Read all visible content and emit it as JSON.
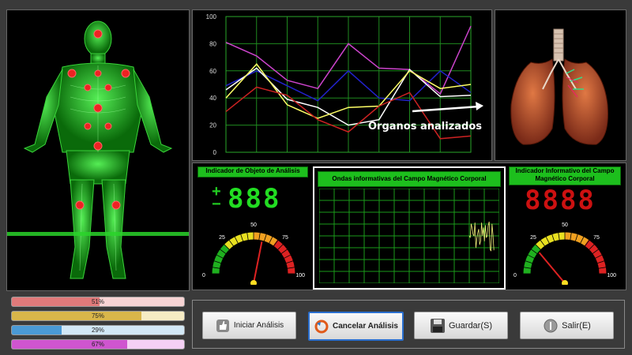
{
  "chart": {
    "yticks": [
      "100",
      "80",
      "60",
      "40",
      "20",
      "0"
    ],
    "series": [
      {
        "color": "#cc44cc",
        "values": [
          81,
          71,
          53,
          47,
          80,
          62,
          61,
          43,
          93
        ]
      },
      {
        "color": "#2222cc",
        "values": [
          49,
          60,
          49,
          38,
          60,
          40,
          38,
          60,
          44
        ]
      },
      {
        "color": "#ffffff",
        "values": [
          46,
          62,
          39,
          33,
          20,
          24,
          61,
          41,
          42
        ]
      },
      {
        "color": "#ffff66",
        "values": [
          40,
          65,
          35,
          25,
          33,
          34,
          60,
          47,
          50
        ]
      },
      {
        "color": "#cc2222",
        "values": [
          30,
          48,
          42,
          24,
          15,
          34,
          44,
          10,
          12
        ]
      }
    ],
    "ymax": 100,
    "annotation": "Organos analizados"
  },
  "gauges": {
    "left_title": "Indicador de Objeto de Análisis",
    "middle_title": "Ondas informativas del Campo Magnético Corporal",
    "right_title": "Indicador Informativo del Campo Magnético Corporal",
    "left_digits": "888",
    "left_plus": "+",
    "left_minus": "−",
    "right_digits": "8888",
    "scale": [
      "0",
      "25",
      "50",
      "75",
      "100"
    ],
    "left_level": 0.58,
    "right_level": 0.22
  },
  "progress": [
    {
      "label": "51%",
      "value": 51,
      "color": "#e07a7a",
      "bg": "#f7d4d4"
    },
    {
      "label": "75%",
      "value": 75,
      "color": "#d9b64a",
      "bg": "#f6ecc4"
    },
    {
      "label": "29%",
      "value": 29,
      "color": "#4a9ad6",
      "bg": "#d2e8f6"
    },
    {
      "label": "67%",
      "value": 67,
      "color": "#cf55cf",
      "bg": "#f4d0f4"
    }
  ],
  "buttons": {
    "start": "Iniciar Análisis",
    "cancel": "Cancelar Análisis",
    "save": "Guardar(S)",
    "exit": "Salir(E)"
  }
}
